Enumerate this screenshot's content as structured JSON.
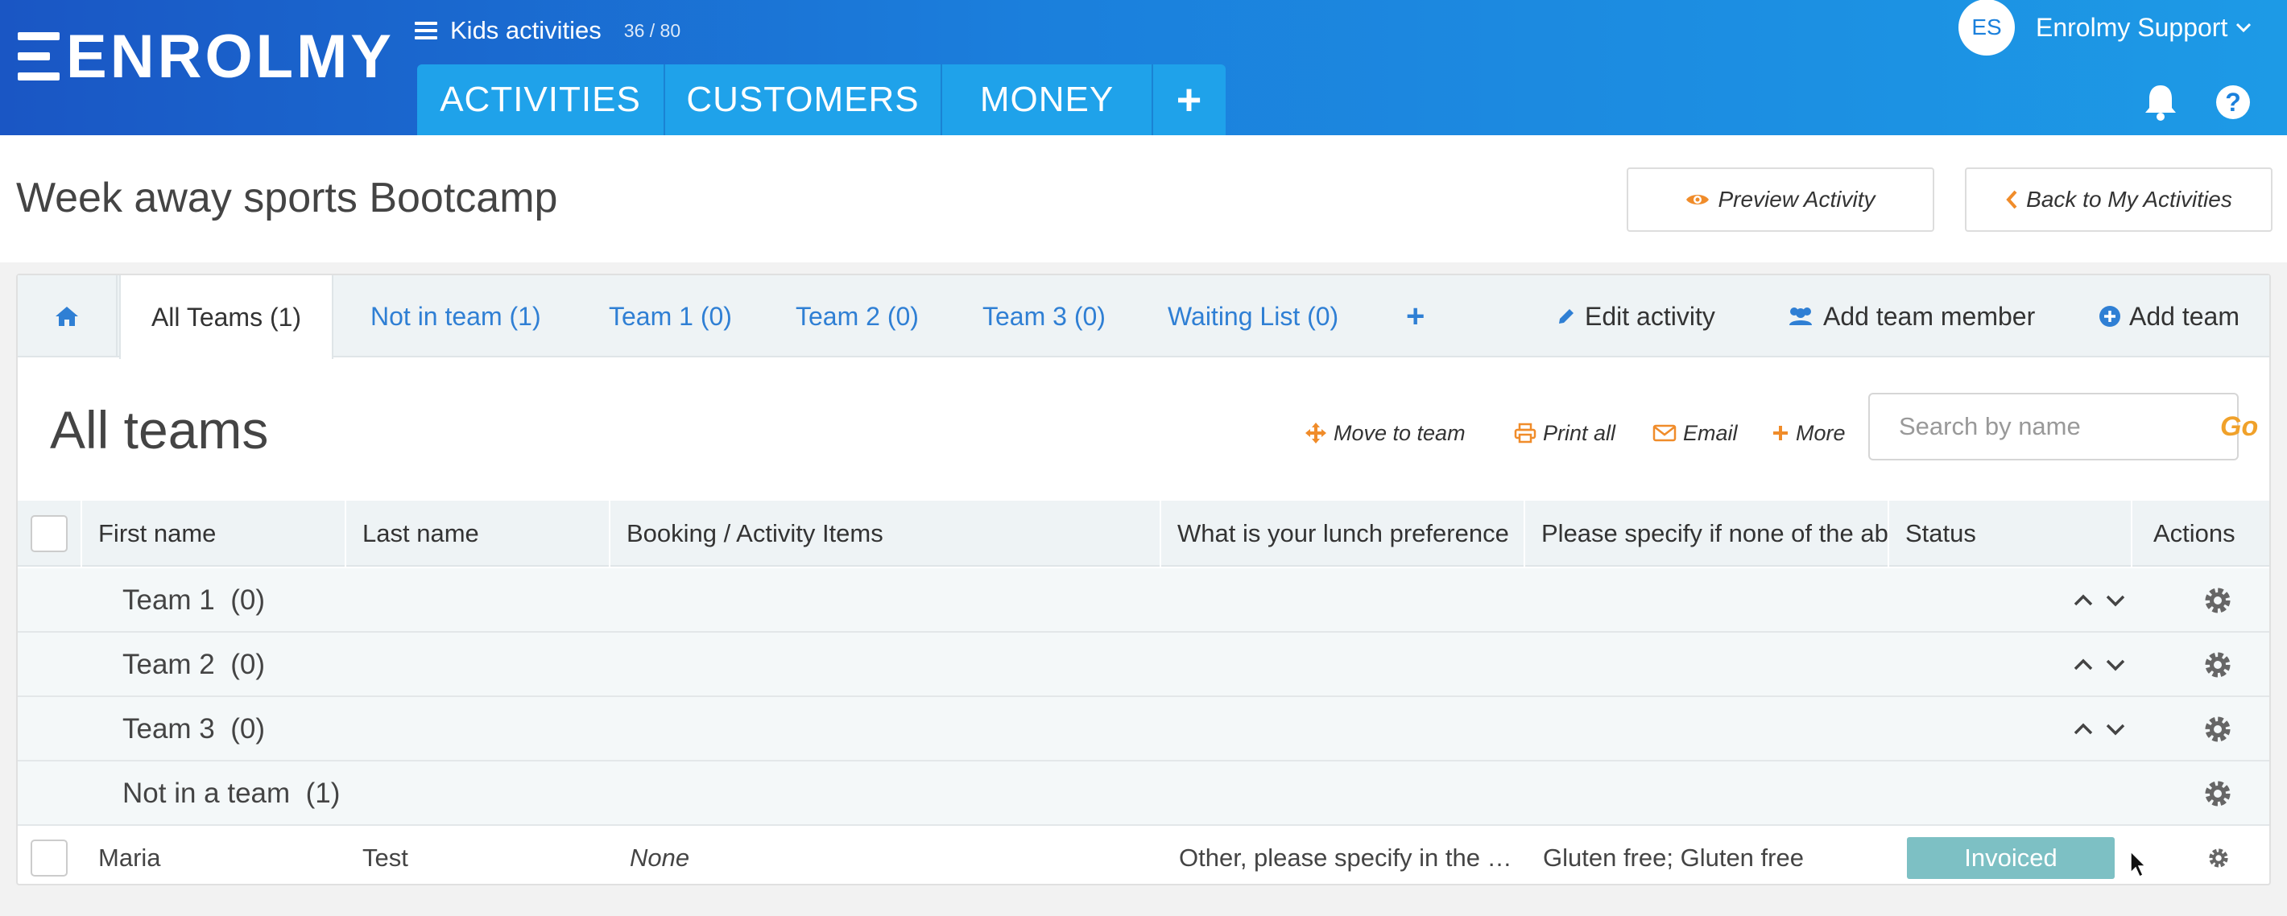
{
  "app": {
    "brand": "ENROLMY",
    "context_title": "Kids activities",
    "context_count": "36 / 80",
    "nav": [
      "ACTIVITIES",
      "CUSTOMERS",
      "MONEY",
      "+"
    ],
    "user_initials": "ES",
    "user_name": "Enrolmy Support"
  },
  "page": {
    "title": "Week away sports Bootcamp",
    "preview_label": "Preview Activity",
    "back_label": "Back to My Activities"
  },
  "tabs": {
    "items": [
      "All Teams (1)",
      "Not in team (1)",
      "Team 1 (0)",
      "Team 2 (0)",
      "Team 3 (0)",
      "Waiting List (0)"
    ],
    "add": "+",
    "edit_activity": "Edit activity",
    "add_team_member": "Add team member",
    "add_team": "Add team"
  },
  "section": {
    "title": "All teams",
    "move_to_team": "Move to team",
    "print_all": "Print all",
    "email": "Email",
    "more": "More",
    "search_placeholder": "Search by name",
    "go": "Go"
  },
  "table": {
    "columns": [
      "First name",
      "Last name",
      "Booking / Activity Items",
      "What is your lunch preference",
      "Please specify if none of the above",
      "Status",
      "Actions"
    ],
    "groups": [
      {
        "name": "Team 1",
        "count": "(0)"
      },
      {
        "name": "Team 2",
        "count": "(0)"
      },
      {
        "name": "Team 3",
        "count": "(0)"
      },
      {
        "name": "Not in a team",
        "count": "(1)"
      }
    ],
    "rows": [
      {
        "first_name": "Maria",
        "last_name": "Test",
        "booking": "None",
        "lunch": "Other, please specify in the …",
        "specify": "Gluten free; Gluten free",
        "status": "Invoiced"
      }
    ]
  },
  "colors": {
    "header_start": "#1a56c4",
    "header_end": "#1d9ae6",
    "link_blue": "#2f7fd4",
    "accent_orange": "#f08c2a",
    "status_invoiced": "#7dc0c4"
  }
}
